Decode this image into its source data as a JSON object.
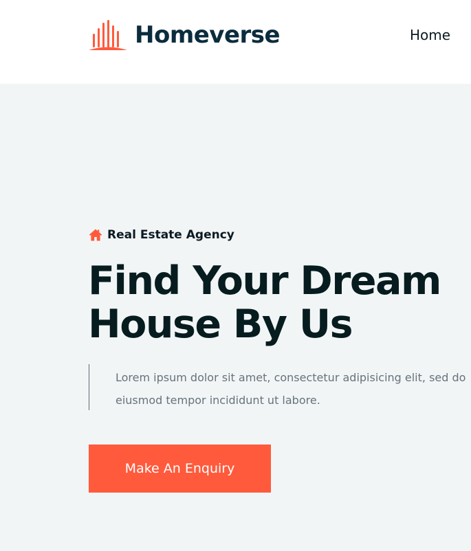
{
  "header": {
    "logo_text": "Homeverse",
    "nav": {
      "home": "Home"
    }
  },
  "hero": {
    "subtitle": "Real Estate Agency",
    "title_line1": "Find Your Dream",
    "title_line2": "House By Us",
    "description": "Lorem ipsum dolor sit amet, consectetur adipisicing elit, sed do eiusmod tempor incididunt ut labore.",
    "cta_label": "Make An Enquiry"
  },
  "icons": {
    "logo": "building-bars-icon",
    "subtitle": "house-icon"
  },
  "colors": {
    "accent": "#ff5a3c",
    "brand_text": "#0b2c3d",
    "hero_bg": "#f2f5f6",
    "heading": "#071c1f",
    "body_text": "#66737a"
  }
}
